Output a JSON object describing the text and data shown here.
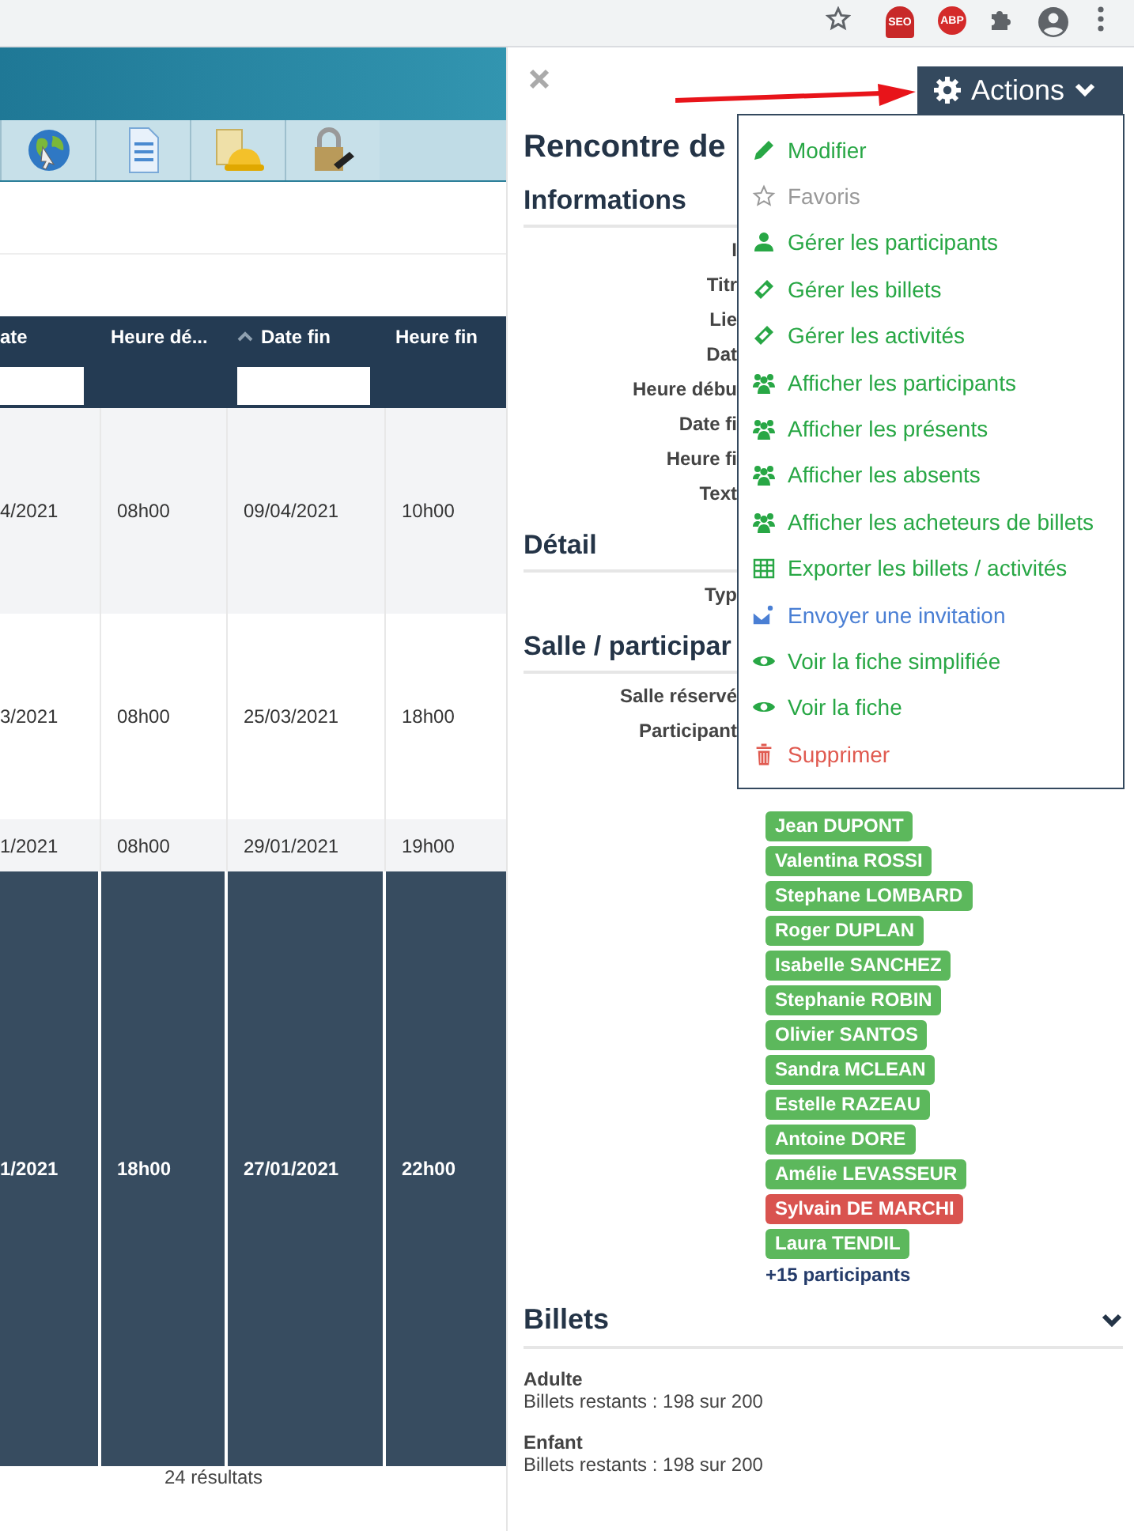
{
  "browser": {
    "extensions": [
      {
        "label": "SEO",
        "kind": "seo"
      },
      {
        "label": "ABP",
        "kind": "abp"
      }
    ]
  },
  "table": {
    "columns": [
      {
        "label": "ate",
        "filter": true,
        "sorted": false
      },
      {
        "label": "Heure dé...",
        "filter": false,
        "sorted": false
      },
      {
        "label": "Date fin",
        "filter": true,
        "sorted": true
      },
      {
        "label": "Heure fin",
        "filter": false,
        "sorted": false
      }
    ],
    "rows": [
      {
        "cells": [
          "4/2021",
          "08h00",
          "09/04/2021",
          "10h00"
        ],
        "selected": false
      },
      {
        "cells": [
          "3/2021",
          "08h00",
          "25/03/2021",
          "18h00"
        ],
        "selected": false
      },
      {
        "cells": [
          "1/2021",
          "08h00",
          "29/01/2021",
          "19h00"
        ],
        "selected": false
      },
      {
        "cells": [
          "1/2021",
          "18h00",
          "27/01/2021",
          "22h00"
        ],
        "selected": true
      }
    ],
    "footer": "24 résultats"
  },
  "panel": {
    "title": "Rencontre de",
    "actions_label": "Actions",
    "menu": [
      {
        "label": "Modifier",
        "kind": "pencil",
        "color": "#28a745"
      },
      {
        "label": "Favoris",
        "kind": "star",
        "color": "#999999"
      },
      {
        "label": "Gérer les participants",
        "kind": "user",
        "color": "#28a745"
      },
      {
        "label": "Gérer les billets",
        "kind": "ticket",
        "color": "#28a745"
      },
      {
        "label": "Gérer les activités",
        "kind": "ticket",
        "color": "#28a745"
      },
      {
        "label": "Afficher les participants",
        "kind": "users",
        "color": "#28a745"
      },
      {
        "label": "Afficher les présents",
        "kind": "users",
        "color": "#28a745"
      },
      {
        "label": "Afficher les absents",
        "kind": "users",
        "color": "#28a745"
      },
      {
        "label": "Afficher les acheteurs de billets",
        "kind": "users",
        "color": "#28a745"
      },
      {
        "label": "Exporter les billets / activités",
        "kind": "table",
        "color": "#28a745"
      },
      {
        "label": "Envoyer une invitation",
        "kind": "mail",
        "color": "#4a7fd4"
      },
      {
        "label": "Voir la fiche simplifiée",
        "kind": "eye",
        "color": "#28a745"
      },
      {
        "label": "Voir la fiche",
        "kind": "eye",
        "color": "#28a745"
      },
      {
        "label": "Supprimer",
        "kind": "trash",
        "color": "#e05a50"
      }
    ],
    "sections": [
      {
        "heading": "Informations",
        "fields": [
          "I",
          "Titr",
          "Lie",
          "Dat",
          "Heure débu",
          "Date fi",
          "Heure fi",
          "Text"
        ]
      },
      {
        "heading": "Détail",
        "fields": [
          "Typ"
        ]
      },
      {
        "heading": "Salle / participar",
        "fields": [
          "Salle réservé",
          "Participant"
        ]
      }
    ],
    "participants": [
      {
        "name": "Jean DUPONT",
        "color": "#5cb85c"
      },
      {
        "name": "Valentina ROSSI",
        "color": "#5cb85c"
      },
      {
        "name": "Stephane LOMBARD",
        "color": "#5cb85c"
      },
      {
        "name": "Roger DUPLAN",
        "color": "#5cb85c"
      },
      {
        "name": "Isabelle SANCHEZ",
        "color": "#5cb85c"
      },
      {
        "name": "Stephanie ROBIN",
        "color": "#5cb85c"
      },
      {
        "name": "Olivier SANTOS",
        "color": "#5cb85c"
      },
      {
        "name": "Sandra MCLEAN",
        "color": "#5cb85c"
      },
      {
        "name": "Estelle RAZEAU",
        "color": "#5cb85c"
      },
      {
        "name": "Antoine DORE",
        "color": "#5cb85c"
      },
      {
        "name": "Amélie LEVASSEUR",
        "color": "#5cb85c"
      },
      {
        "name": "Sylvain DE MARCHI",
        "color": "#d9534f"
      },
      {
        "name": "Laura TENDIL",
        "color": "#5cb85c"
      }
    ],
    "more_participants": "+15 participants",
    "billets": {
      "heading": "Billets",
      "expanded": false,
      "tickets": [
        {
          "name": "Adulte",
          "remaining": "Billets restants : 198 sur 200"
        },
        {
          "name": "Enfant",
          "remaining": "Billets restants : 198 sur 200"
        }
      ]
    }
  }
}
